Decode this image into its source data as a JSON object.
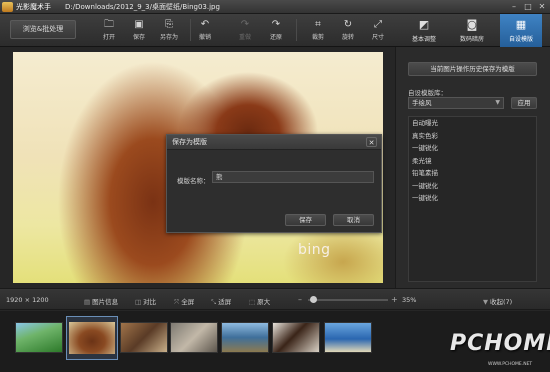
{
  "app": {
    "name": "光影魔术手",
    "file_path": "D:/Downloads/2012_9_3/桌面壁纸/Bing03.jpg"
  },
  "window_controls": {
    "minimize": "–",
    "maximize": "□",
    "close": "✕"
  },
  "toolbar": {
    "browse_label": "浏览&批处理",
    "tools": [
      {
        "label": "打开",
        "icon": "open-folder-icon",
        "glyph": "🗀",
        "enabled": true
      },
      {
        "label": "保存",
        "icon": "save-icon",
        "glyph": "▣",
        "enabled": true
      },
      {
        "label": "另存为",
        "icon": "save-as-icon",
        "glyph": "⎘",
        "enabled": true
      },
      {
        "label": "撤销",
        "icon": "undo-icon",
        "glyph": "↶",
        "enabled": true
      },
      {
        "label": "重做",
        "icon": "redo-icon",
        "glyph": "↷",
        "enabled": false
      },
      {
        "label": "还原",
        "icon": "restore-icon",
        "glyph": "↷",
        "enabled": true
      },
      {
        "label": "裁剪",
        "icon": "crop-icon",
        "glyph": "⌗",
        "enabled": true
      },
      {
        "label": "旋转",
        "icon": "rotate-icon",
        "glyph": "↻",
        "enabled": true
      },
      {
        "label": "尺寸",
        "icon": "resize-icon",
        "glyph": "⤢",
        "enabled": true
      }
    ],
    "modes": [
      {
        "label": "基本调整",
        "icon": "basic-adjust-icon",
        "glyph": "◩",
        "active": false
      },
      {
        "label": "数码暗房",
        "icon": "camera-icon",
        "glyph": "◙",
        "active": false
      },
      {
        "label": "自设模版",
        "icon": "template-icon",
        "glyph": "▦",
        "active": true
      }
    ]
  },
  "canvas": {
    "watermark": "bing"
  },
  "dialog": {
    "title": "保存为模版",
    "name_label": "模版名称：",
    "name_value": "熊",
    "save_label": "保存",
    "cancel_label": "取消",
    "close_glyph": "✕"
  },
  "right_panel": {
    "history_button": "当前图片操作历史保存为模版",
    "library_label": "自设模版库：",
    "library_selected": "手绘风",
    "apply_label": "应用",
    "presets": [
      "自动曝光",
      "真实色彩",
      "一键锐化",
      "柔光镜",
      "铅笔素描",
      "一键锐化",
      "一键锐化"
    ]
  },
  "status_bar": {
    "resolution": "1920 × 1200",
    "tools": [
      {
        "label": "图片信息",
        "icon": "info-icon",
        "glyph": "▤"
      },
      {
        "label": "对比",
        "icon": "compare-icon",
        "glyph": "◫"
      },
      {
        "label": "全屏",
        "icon": "fullscreen-icon",
        "glyph": "⤧"
      },
      {
        "label": "适屏",
        "icon": "fit-screen-icon",
        "glyph": "⤡"
      },
      {
        "label": "原大",
        "icon": "actual-size-icon",
        "glyph": "⬚"
      }
    ],
    "zoom_minus": "–",
    "zoom_plus": "+",
    "zoom_percent": "35%",
    "zoom_level": 0.35,
    "collapse_label": "收起(7)",
    "collapse_glyph": "▼"
  },
  "filmstrip": {
    "thumbnails": [
      {
        "name": "green-field"
      },
      {
        "name": "bears",
        "selected": true
      },
      {
        "name": "rocks"
      },
      {
        "name": "monkey"
      },
      {
        "name": "coast"
      },
      {
        "name": "horse"
      },
      {
        "name": "beach"
      }
    ]
  },
  "branding": {
    "logo": "PCHOME",
    "url": "WWW.PCHOME.NET"
  }
}
